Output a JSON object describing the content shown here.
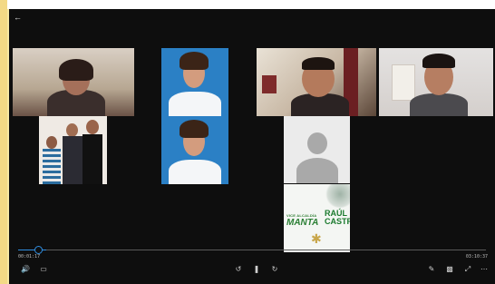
{
  "player": {
    "back_icon": "arrow-left-icon",
    "time_elapsed": "00:01:17",
    "time_total": "03:10:37",
    "progress_fraction": 0.06,
    "accent_color": "#2f8ee0"
  },
  "ad": {
    "line1": "VICE ALCALDÍA",
    "raul": "RAÚL",
    "manta": "MANTA",
    "castro": "CASTRO"
  },
  "controls": {
    "volume_icon": "volume-icon",
    "captions_icon": "captions-icon",
    "rewind_icon": "rewind-10-icon",
    "play_pause_icon": "pause-icon",
    "forward_icon": "forward-30-icon",
    "pen_icon": "pen-icon",
    "miniplayer_icon": "miniplayer-icon",
    "fullscreen_icon": "fullscreen-icon",
    "more_icon": "more-icon"
  }
}
